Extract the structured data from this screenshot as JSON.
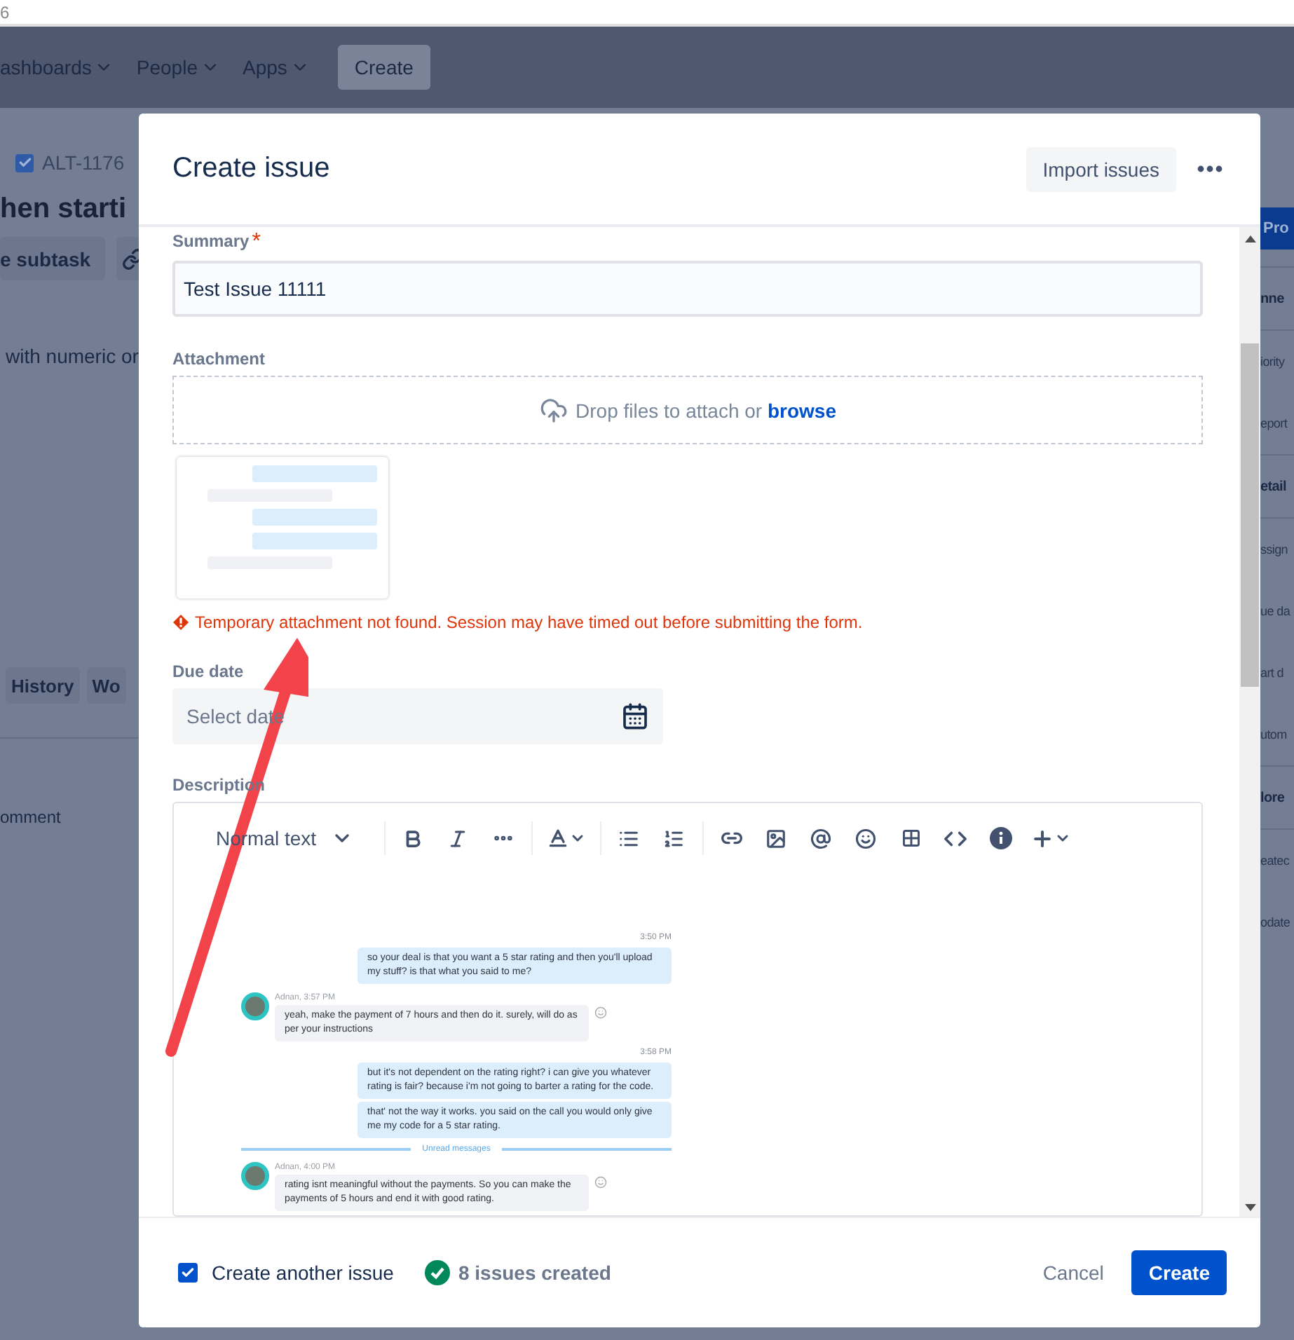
{
  "browser_fragment": "6",
  "nav": {
    "items": [
      {
        "label": "ashboards"
      },
      {
        "label": "People"
      },
      {
        "label": "Apps"
      }
    ],
    "create_button": "Create"
  },
  "background_page": {
    "issue_key": "ALT-1176",
    "title_fragment": "hen starti",
    "subtask_button": "e subtask",
    "text_fragment": "with numeric or",
    "tabs": [
      {
        "label": "History"
      },
      {
        "label": "Wo"
      }
    ],
    "comment_fragment": "omment",
    "right_items": [
      {
        "kind": "button",
        "text": "Pro"
      },
      {
        "kind": "heading",
        "text": "nne"
      },
      {
        "kind": "field",
        "text": "iority"
      },
      {
        "kind": "field",
        "text": "eport"
      },
      {
        "kind": "heading",
        "text": "etail"
      },
      {
        "kind": "field",
        "text": "ssign"
      },
      {
        "kind": "field",
        "text": "ue da"
      },
      {
        "kind": "field",
        "text": "art d"
      },
      {
        "kind": "field",
        "text": "utom"
      },
      {
        "kind": "heading",
        "text": "lore"
      },
      {
        "kind": "field",
        "text": "eatec"
      },
      {
        "kind": "field",
        "text": "odate"
      }
    ]
  },
  "modal": {
    "title": "Create issue",
    "import_button": "Import issues",
    "summary": {
      "label": "Summary",
      "required_mark": "*",
      "value": "Test Issue 11111"
    },
    "attachment": {
      "label": "Attachment",
      "drop_text": "Drop files to attach or",
      "browse_link": "browse",
      "error": "Temporary attachment not found. Session may have timed out before submitting the form."
    },
    "due_date": {
      "label": "Due date",
      "placeholder": "Select date"
    },
    "description": {
      "label": "Description",
      "text_style": "Normal text",
      "chat": [
        {
          "kind": "time",
          "text": "3:50 PM"
        },
        {
          "kind": "outgoing",
          "text": "so your deal is that you want a 5 star rating and then you'll upload my stuff?  is that what you said to me?"
        },
        {
          "kind": "incoming",
          "sender": "Adnan, 3:57 PM",
          "text": "yeah, make the payment of 7 hours and then do it. surely, will do as per your instructions"
        },
        {
          "kind": "time",
          "text": "3:58 PM"
        },
        {
          "kind": "outgoing",
          "text": "but it's not dependent on the rating right?  i can give you whatever rating is fair?  because i'm not going to barter a rating for the code."
        },
        {
          "kind": "outgoing",
          "text": "that' not the way it works.  you said on the call you would only give me my code for a 5 star rating."
        },
        {
          "kind": "unread",
          "text": "Unread messages"
        },
        {
          "kind": "incoming",
          "sender": "Adnan, 4:00 PM",
          "text": "rating isnt meaningful without the payments. So you can make the payments of 5 hours and end it with good rating."
        }
      ]
    },
    "footer": {
      "create_another": {
        "label": "Create another issue",
        "checked": true
      },
      "status": "8 issues created",
      "cancel": "Cancel",
      "create": "Create"
    }
  }
}
